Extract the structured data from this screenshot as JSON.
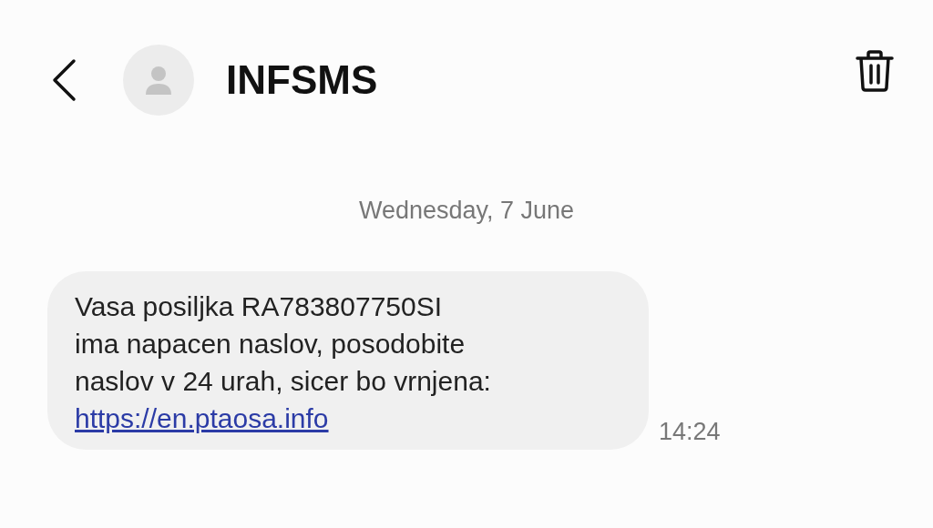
{
  "header": {
    "title": "INFSMS"
  },
  "date_divider": "Wednesday, 7 June",
  "messages": [
    {
      "text": "Vasa posiljka RA783807750SI\nima napacen naslov, posodobite\nnaslov v 24 urah, sicer bo vrnjena:",
      "link": "https://en.ptaosa.info",
      "time": "14:24"
    }
  ]
}
